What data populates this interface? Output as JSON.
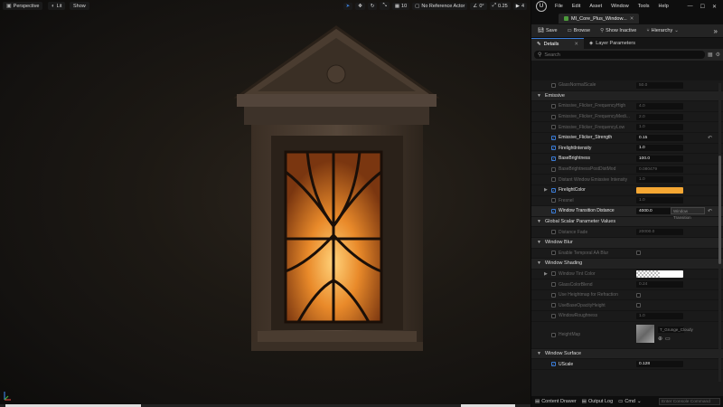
{
  "viewport": {
    "perspective_label": "Perspective",
    "lit_label": "Lit",
    "show_label": "Show",
    "grid_count": "10",
    "reference_label": "No Reference Actor",
    "angle_value": "0°",
    "scale_value": "0.25",
    "speed_value": "4"
  },
  "editor": {
    "menus": [
      "File",
      "Edit",
      "Asset",
      "Window",
      "Tools",
      "Help"
    ],
    "asset_tab": "MI_Core_Plus_Window...",
    "toolbar": {
      "save": "Save",
      "browse": "Browse",
      "show_inactive": "Show Inactive",
      "hierarchy": "Hierarchy"
    },
    "tabs": {
      "details": "Details",
      "layer_parameters": "Layer Parameters"
    },
    "search_placeholder": "Search",
    "rows": {
      "r0": {
        "name": "GlassNormalScale",
        "value": "50.0"
      },
      "cat_emissive": "Emissive",
      "r1": {
        "name": "Emissive_Flicker_FrequencyHigh",
        "value": "4.0"
      },
      "r2": {
        "name": "Emissive_Flicker_FrequencyMedi...",
        "value": "2.0"
      },
      "r3": {
        "name": "Emissive_Flicker_FrequencyLow",
        "value": "1.0"
      },
      "r4": {
        "name": "Emissive_Flicker_Strength",
        "value": "0.15"
      },
      "r5": {
        "name": "FirelightIntensity",
        "value": "1.0"
      },
      "r6": {
        "name": "BaseBrightness",
        "value": "100.0"
      },
      "r7": {
        "name": "BaseBrightnessPostDistMod",
        "value": "0.080479"
      },
      "r8": {
        "name": "Distant Window Emissive Intensity",
        "value": "1.0"
      },
      "r9": {
        "name": "FirelightColor"
      },
      "r10": {
        "name": "Fresnel",
        "value": "1.0"
      },
      "r11": {
        "name": "Window Transition Distance",
        "value": "4000.0",
        "tooltip": "Window Transition"
      },
      "cat_global": "Global Scalar Parameter Values",
      "r12": {
        "name": "Distance Fade",
        "value": "20000.0"
      },
      "cat_blur": "Window Blur",
      "r13": {
        "name": "Enable Temporal AA Blur"
      },
      "cat_shading": "Window Shading",
      "r14": {
        "name": "Window Tint Color"
      },
      "r15": {
        "name": "GlassColorBlend",
        "value": "0.24"
      },
      "r16": {
        "name": "Use Heightmap for Refraction"
      },
      "r17": {
        "name": "UseBaseOpacityHeight"
      },
      "r18": {
        "name": "WindowRoughness",
        "value": "1.0"
      },
      "r19": {
        "name": "HeightMap",
        "texture": "T_Grunge_Cloudy"
      },
      "cat_surface": "Window Surface",
      "r20": {
        "name": "UScale",
        "value": "0.128"
      }
    },
    "status": {
      "content_drawer": "Content Drawer",
      "output_log": "Output Log",
      "cmd": "Cmd",
      "console_placeholder": "Enter Console Command"
    }
  },
  "colors": {
    "firelight": "#f5a733",
    "accent": "#3a7bd5"
  }
}
